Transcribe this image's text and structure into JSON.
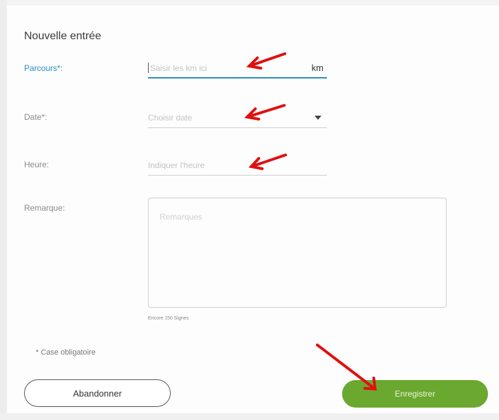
{
  "form": {
    "title": "Nouvelle entrée",
    "fields": {
      "parcours": {
        "label": "Parcours*:",
        "placeholder": "Saisir les km ici",
        "unit": "km"
      },
      "date": {
        "label": "Date*:",
        "placeholder": "Choisir date"
      },
      "heure": {
        "label": "Heure:",
        "placeholder": "Indiquer l'heure"
      },
      "remarque": {
        "label": "Remarque:",
        "placeholder": "Remarques",
        "hint": "Encore 150 Signes"
      }
    },
    "required_note": "* Case obligatoire"
  },
  "buttons": {
    "cancel_label": "Abandonner",
    "save_label": "Enregistrer"
  },
  "colors": {
    "accent": "#2a8fc4",
    "save_button": "#6aa82f",
    "annotation_arrow": "#e01010"
  }
}
